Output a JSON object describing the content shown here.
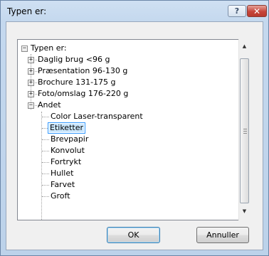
{
  "window": {
    "title": "Typen er:",
    "help_label": "?",
    "close_label": "✕"
  },
  "tree": {
    "root_label": "Typen er:",
    "root_expander": "−",
    "groups": [
      {
        "label": "Daglig brug <96 g",
        "expander": "+"
      },
      {
        "label": "Præsentation 96-130 g",
        "expander": "+"
      },
      {
        "label": "Brochure 131-175 g",
        "expander": "+"
      },
      {
        "label": "Foto/omslag 176-220 g",
        "expander": "+"
      },
      {
        "label": "Andet",
        "expander": "−"
      }
    ],
    "children": [
      "Color Laser-transparent",
      "Etiketter",
      "Brevpapir",
      "Konvolut",
      "Fortrykt",
      "Hullet",
      "Farvet",
      "Groft"
    ],
    "selected_item": "Etiketter"
  },
  "scrollbar": {
    "up_arrow": "▲",
    "down_arrow": "▼"
  },
  "buttons": {
    "ok_label": "OK",
    "cancel_label": "Annuller"
  }
}
